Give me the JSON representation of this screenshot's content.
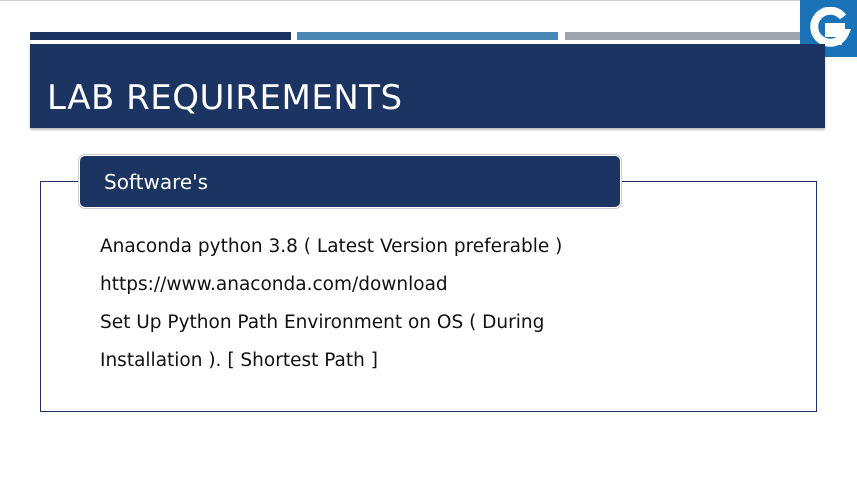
{
  "slide": {
    "title": "LAB REQUIREMENTS",
    "section_heading": "Software's",
    "lines": [
      "Anaconda python 3.8 ( Latest Version preferable )",
      "https://www.anaconda.com/download",
      "Set Up Python Path Environment on OS ( During",
      "Installation ). [ Shortest Path ]"
    ]
  },
  "logo": {
    "icon": "g-logo-icon",
    "color": "#1a73b8"
  },
  "colors": {
    "navy": "#1c3461",
    "accent_blue": "#4a89b5",
    "accent_gray": "#9fa3ad"
  }
}
